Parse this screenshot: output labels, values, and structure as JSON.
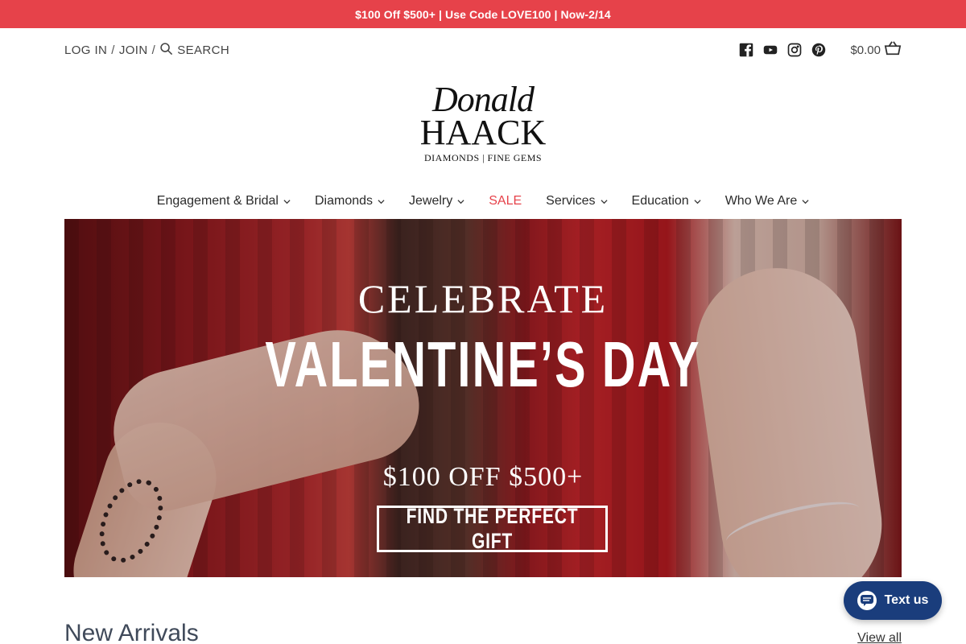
{
  "announcement": "$100 Off $500+ | Use Code LOVE100 | Now-2/14",
  "header": {
    "login": "LOG IN",
    "join": "JOIN",
    "separator": "/",
    "search": "SEARCH",
    "social": [
      "facebook-icon",
      "youtube-icon",
      "instagram-icon",
      "pinterest-icon"
    ],
    "cart_total": "$0.00"
  },
  "logo": {
    "line1": "Donald",
    "line2": "HAACK",
    "line3": "DIAMONDS | FINE GEMS"
  },
  "nav": {
    "items": [
      {
        "label": "Engagement & Bridal"
      },
      {
        "label": "Diamonds"
      },
      {
        "label": "Jewelry"
      },
      {
        "label": "SALE"
      },
      {
        "label": "Services"
      },
      {
        "label": "Education"
      },
      {
        "label": "Who We Are"
      }
    ]
  },
  "hero": {
    "line1": "CELEBRATE",
    "line2": "VALENTINE’S DAY",
    "offer": "$100 OFF $500+",
    "cta": "FIND THE PERFECT GIFT"
  },
  "section": {
    "title": "New Arrivals",
    "view_all": "View all"
  },
  "chat": {
    "label": "Text us"
  },
  "colors": {
    "announcement_bg": "#e6424a",
    "sale": "#e6424a",
    "chat_bg": "#1a3d7c"
  }
}
